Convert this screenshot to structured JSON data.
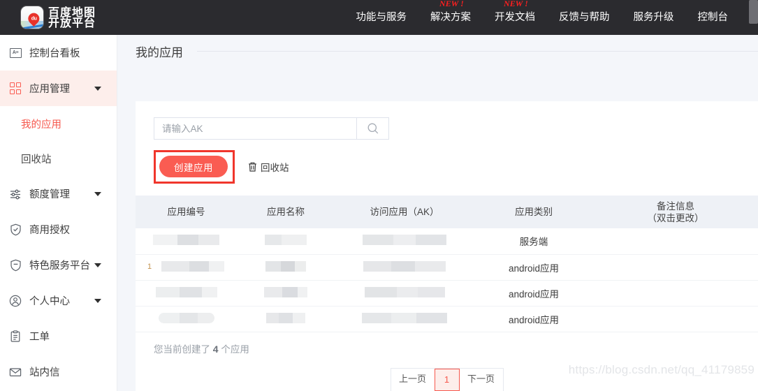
{
  "brand": {
    "logo_line1": "百度地图",
    "logo_line2": "开放平台",
    "logo_pin_text": "du"
  },
  "topnav": {
    "items": [
      {
        "label": "功能与服务",
        "badge": ""
      },
      {
        "label": "解决方案",
        "badge": "NEW !"
      },
      {
        "label": "开发文档",
        "badge": "NEW !"
      },
      {
        "label": "反馈与帮助",
        "badge": ""
      },
      {
        "label": "服务升级",
        "badge": ""
      },
      {
        "label": "控制台",
        "badge": ""
      }
    ]
  },
  "sidebar": {
    "items": [
      {
        "label": "控制台看板",
        "icon": "board-icon",
        "caret": false,
        "active": false
      },
      {
        "label": "应用管理",
        "icon": "grid-icon",
        "caret": true,
        "active": true
      },
      {
        "label": "额度管理",
        "icon": "sliders-icon",
        "caret": true,
        "active": false
      },
      {
        "label": "商用授权",
        "icon": "shield-check-icon",
        "caret": false,
        "active": false
      },
      {
        "label": "特色服务平台",
        "icon": "shield-minus-icon",
        "caret": true,
        "active": false
      },
      {
        "label": "个人中心",
        "icon": "user-circle-icon",
        "caret": true,
        "active": false
      },
      {
        "label": "工单",
        "icon": "clipboard-icon",
        "caret": false,
        "active": false
      },
      {
        "label": "站内信",
        "icon": "envelope-icon",
        "caret": false,
        "active": false
      }
    ],
    "sub_items": [
      {
        "label": "我的应用",
        "current": true
      },
      {
        "label": "回收站",
        "current": false
      }
    ]
  },
  "page": {
    "title": "我的应用"
  },
  "search": {
    "placeholder": "请输入AK",
    "value": "",
    "button_icon": "search-icon"
  },
  "toolbar": {
    "create_label": "创建应用",
    "recycle_label": "回收站",
    "recycle_icon": "trash-icon"
  },
  "table": {
    "columns": [
      {
        "label": "应用编号",
        "sub": ""
      },
      {
        "label": "应用名称",
        "sub": ""
      },
      {
        "label": "访问应用（AK）",
        "sub": ""
      },
      {
        "label": "应用类别",
        "sub": ""
      },
      {
        "label": "备注信息",
        "sub": "（双击更改）"
      }
    ],
    "rows": [
      {
        "app_id": "",
        "app_name": "",
        "ak": "",
        "category": "服务端",
        "remark": ""
      },
      {
        "app_id": "",
        "app_name": "",
        "ak": "",
        "category": "android应用",
        "remark": ""
      },
      {
        "app_id": "",
        "app_name": "",
        "ak": "",
        "category": "android应用",
        "remark": ""
      },
      {
        "app_id": "",
        "app_name": "",
        "ak": "",
        "category": "android应用",
        "remark": ""
      }
    ]
  },
  "footer": {
    "count_prefix": "您当前创建了",
    "count_value": "4",
    "count_suffix": "个应用"
  },
  "pagination": {
    "prev_label": "上一页",
    "current_page": "1",
    "next_label": "下一页"
  },
  "watermark": {
    "text": "https://blog.csdn.net/qq_41179859"
  },
  "colors": {
    "brand_red": "#fa5c52",
    "highlight_red": "#f0362c",
    "topbar_bg": "#2b2b2f",
    "page_bg": "#f4f6fa",
    "active_bg": "#fdeeeb"
  }
}
